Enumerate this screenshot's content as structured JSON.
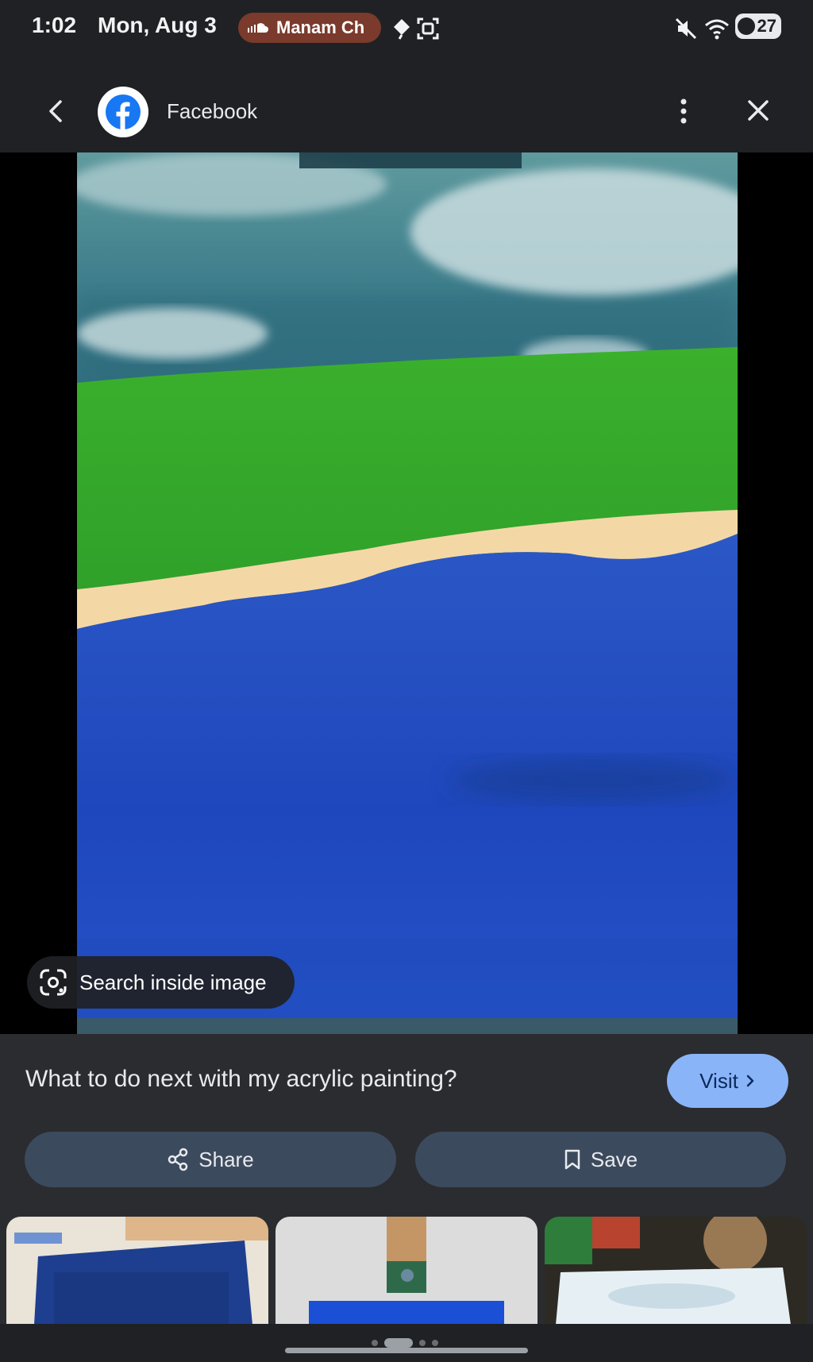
{
  "status_bar": {
    "time": "1:02",
    "date": "Mon, Aug 3",
    "notification_pill": "Manam Ch",
    "battery_level": "27",
    "icons": [
      "soundcloud-icon",
      "location-icon",
      "screenshot-icon",
      "mute-icon",
      "wifi-icon",
      "battery-icon"
    ]
  },
  "app_bar": {
    "source_title": "Facebook",
    "source_logo": "facebook-icon"
  },
  "image": {
    "search_inside_label": "Search inside image"
  },
  "info": {
    "caption": "What to do next with my acrylic painting?",
    "visit_label": "Visit",
    "share_label": "Share",
    "save_label": "Save"
  },
  "colors": {
    "background": "#202124",
    "accent": "#8ab4f8",
    "action_button": "#3c4a5e",
    "notification_pill": "#7a3a2c"
  }
}
